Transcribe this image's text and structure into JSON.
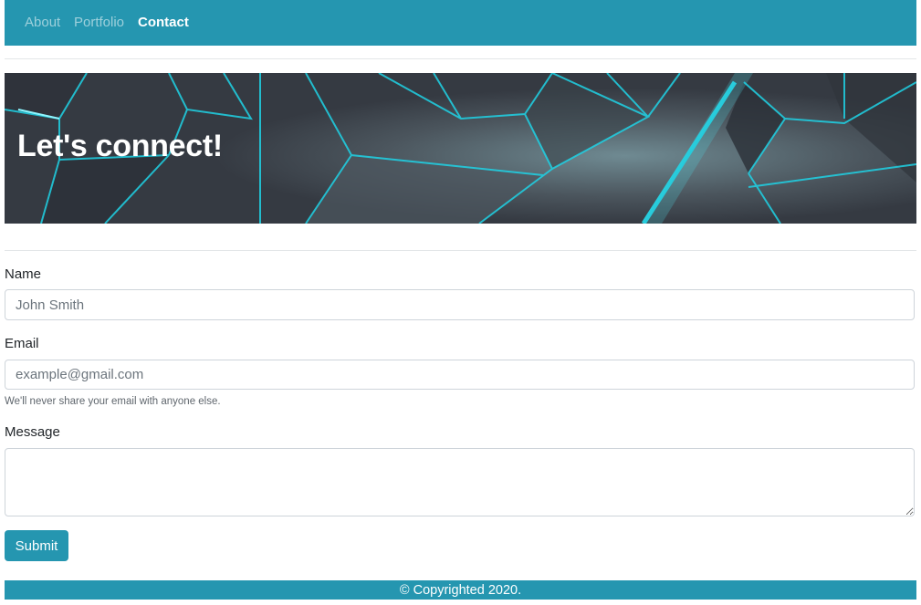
{
  "nav": {
    "items": [
      {
        "label": "About",
        "active": false
      },
      {
        "label": "Portfolio",
        "active": false
      },
      {
        "label": "Contact",
        "active": true
      }
    ]
  },
  "hero": {
    "title": "Let's connect!"
  },
  "form": {
    "name": {
      "label": "Name",
      "placeholder": "John Smith"
    },
    "email": {
      "label": "Email",
      "placeholder": "example@gmail.com",
      "help": "We'll never share your email with anyone else."
    },
    "message": {
      "label": "Message",
      "placeholder": ""
    },
    "submit_label": "Submit"
  },
  "footer": {
    "text": "© Copyrighted 2020."
  },
  "colors": {
    "brand": "#2596b0",
    "hero_line": "#1fd3e6"
  }
}
